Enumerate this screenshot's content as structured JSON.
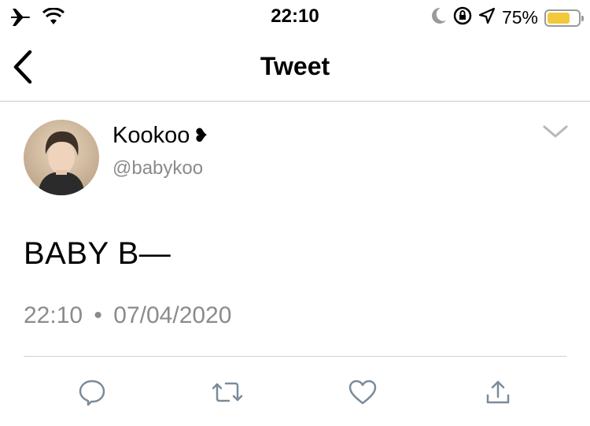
{
  "status_bar": {
    "time": "22:10",
    "battery_percent": "75%",
    "battery_level": 0.75,
    "colors": {
      "battery_fill": "#f4c83b",
      "icons": "#000000"
    },
    "icons": [
      "airplane-icon",
      "wifi-icon",
      "moon-icon",
      "rotation-lock-icon",
      "location-icon",
      "battery-icon"
    ]
  },
  "navbar": {
    "title": "Tweet",
    "back_icon": "chevron-left-icon"
  },
  "tweet": {
    "author_name": "Kookoo",
    "author_emoji": "❥",
    "author_handle": "@babykoo",
    "text": "BABY B—",
    "time": "22:10",
    "separator": "•",
    "date": "07/04/2020",
    "menu_icon": "chevron-down-icon"
  },
  "actions": {
    "icons": [
      "reply-icon",
      "retweet-icon",
      "like-icon",
      "share-icon"
    ],
    "icon_color": "#7a8b99"
  }
}
